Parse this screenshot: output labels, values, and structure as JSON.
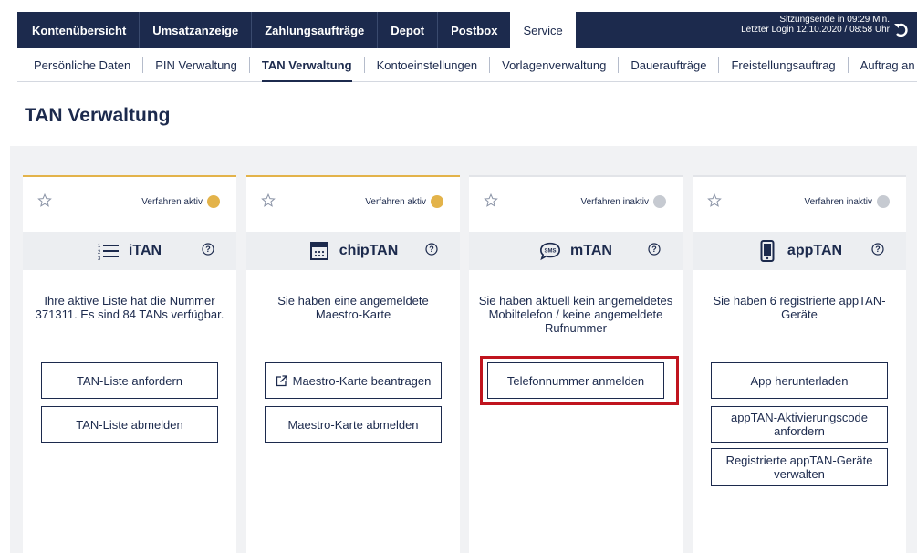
{
  "topnav": {
    "items": [
      "Kontenübersicht",
      "Umsatzanzeige",
      "Zahlungsaufträge",
      "Depot",
      "Postbox",
      "Service"
    ],
    "active": "Service",
    "session_line1": "Sitzungsende in 09:29 Min.",
    "session_line2": "Letzter Login 12.10.2020 / 08:58 Uhr"
  },
  "subnav": {
    "items": [
      "Persönliche Daten",
      "PIN Verwaltung",
      "TAN Verwaltung",
      "Kontoeinstellungen",
      "Vorlagenverwaltung",
      "Daueraufträge",
      "Freistellungsauftrag",
      "Auftrag an die Ban"
    ],
    "active": "TAN Verwaltung"
  },
  "page": {
    "title": "TAN Verwaltung"
  },
  "cards": [
    {
      "name": "iTAN",
      "status": "Verfahren aktiv",
      "active": true,
      "icon": "list-numbered-icon",
      "description": "Ihre aktive Liste hat die Nummer 371311. Es sind 84 TANs verfügbar.",
      "buttons": [
        "TAN-Liste anfordern",
        "TAN-Liste abmelden"
      ]
    },
    {
      "name": "chipTAN",
      "status": "Verfahren aktiv",
      "active": true,
      "icon": "calculator-icon",
      "description": "Sie haben eine angemeldete Maestro-Karte",
      "buttons": [
        "Maestro-Karte beantragen",
        "Maestro-Karte abmelden"
      ]
    },
    {
      "name": "mTAN",
      "status": "Verfahren inaktiv",
      "active": false,
      "icon": "sms-icon",
      "description": "Sie haben aktuell kein angemeldetes Mobiltelefon / keine angemeldete Rufnummer",
      "buttons": [
        "Telefonnummer anmelden"
      ]
    },
    {
      "name": "appTAN",
      "status": "Verfahren inaktiv",
      "active": false,
      "icon": "smartphone-icon",
      "description": "Sie haben 6 registrierte appTAN-Geräte",
      "buttons": [
        "App herunterladen",
        "appTAN-Aktivierungscode anfordern",
        "Registrierte appTAN-Geräte verwalten"
      ]
    }
  ],
  "colors": {
    "nav_bg": "#1c2a4d",
    "active_dot": "#e3b34a",
    "inactive_dot": "#c6cad1",
    "highlight": "#c0141e"
  }
}
